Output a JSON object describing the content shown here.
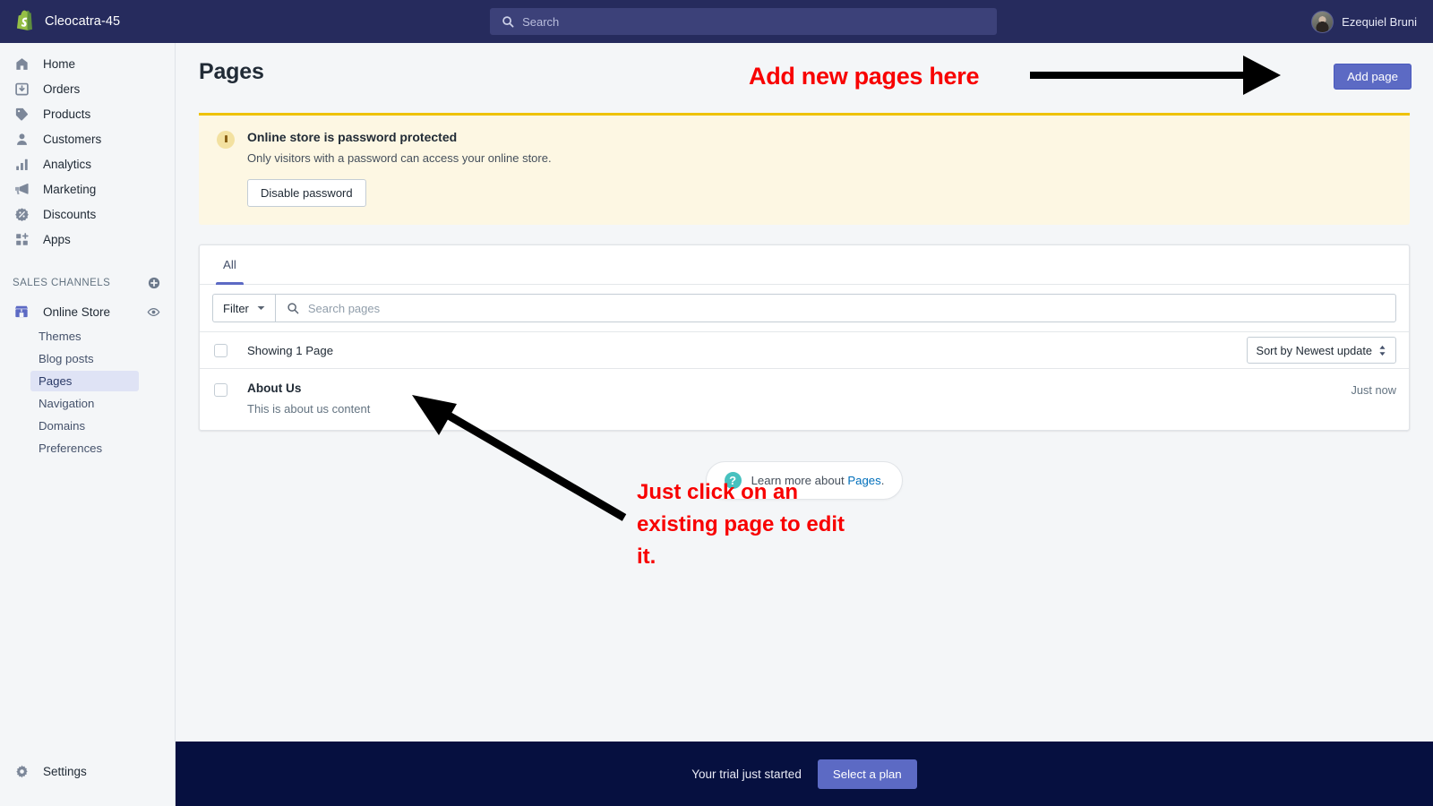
{
  "topbar": {
    "brand_name": "Cleocatra-45",
    "logo_icon": "shopify-bag-logo",
    "search_icon": "search-icon",
    "search_placeholder": "Search",
    "search_value": "",
    "user_name": "Ezequiel Bruni",
    "avatar_icon": "user-avatar"
  },
  "sidebar": {
    "items": [
      {
        "label": "Home",
        "icon": "home-icon"
      },
      {
        "label": "Orders",
        "icon": "orders-inbox-icon"
      },
      {
        "label": "Products",
        "icon": "products-tag-icon"
      },
      {
        "label": "Customers",
        "icon": "customers-person-icon"
      },
      {
        "label": "Analytics",
        "icon": "analytics-bars-icon"
      },
      {
        "label": "Marketing",
        "icon": "marketing-megaphone-icon"
      },
      {
        "label": "Discounts",
        "icon": "discounts-percent-icon"
      },
      {
        "label": "Apps",
        "icon": "apps-grid-plus-icon"
      }
    ],
    "section_title": "SALES CHANNELS",
    "section_add_icon": "plus-circle-icon",
    "channel": {
      "label": "Online Store",
      "icon": "storefront-icon",
      "view_icon": "eye-icon"
    },
    "sub_items": [
      {
        "label": "Themes",
        "active": false
      },
      {
        "label": "Blog posts",
        "active": false
      },
      {
        "label": "Pages",
        "active": true
      },
      {
        "label": "Navigation",
        "active": false
      },
      {
        "label": "Domains",
        "active": false
      },
      {
        "label": "Preferences",
        "active": false
      }
    ],
    "settings": {
      "label": "Settings",
      "icon": "gear-icon"
    }
  },
  "page": {
    "title": "Pages",
    "add_button": "Add page"
  },
  "banner": {
    "icon": "alert-exclamation-icon",
    "title": "Online store is password protected",
    "text": "Only visitors with a password can access your online store.",
    "button": "Disable password",
    "accent_color": "#eec200",
    "background_color": "#fdf7e3"
  },
  "card": {
    "tabs": [
      {
        "label": "All",
        "active": true
      }
    ],
    "filter_button": "Filter",
    "filter_caret_icon": "chevron-down-icon",
    "search_icon": "search-icon",
    "search_placeholder": "Search pages",
    "search_value": "",
    "list_header": {
      "label": "Showing 1 Page",
      "checkbox_icon": "checkbox-unchecked",
      "sort_label": "Sort by Newest update",
      "sort_icon": "sort-updown-icon"
    },
    "rows": [
      {
        "title": "About Us",
        "excerpt": "This is about us content",
        "time": "Just now",
        "checkbox_icon": "checkbox-unchecked"
      }
    ]
  },
  "help": {
    "icon": "question-circle-icon",
    "prefix": "Learn more about ",
    "link": "Pages",
    "suffix": "."
  },
  "footer": {
    "trial_text": "Your trial just started",
    "button": "Select a plan"
  },
  "annotations": {
    "top_text": "Add new pages here",
    "bottom_text": "Just click on an existing page to edit it.",
    "color": "#f80000",
    "arrow_color": "#000000"
  }
}
